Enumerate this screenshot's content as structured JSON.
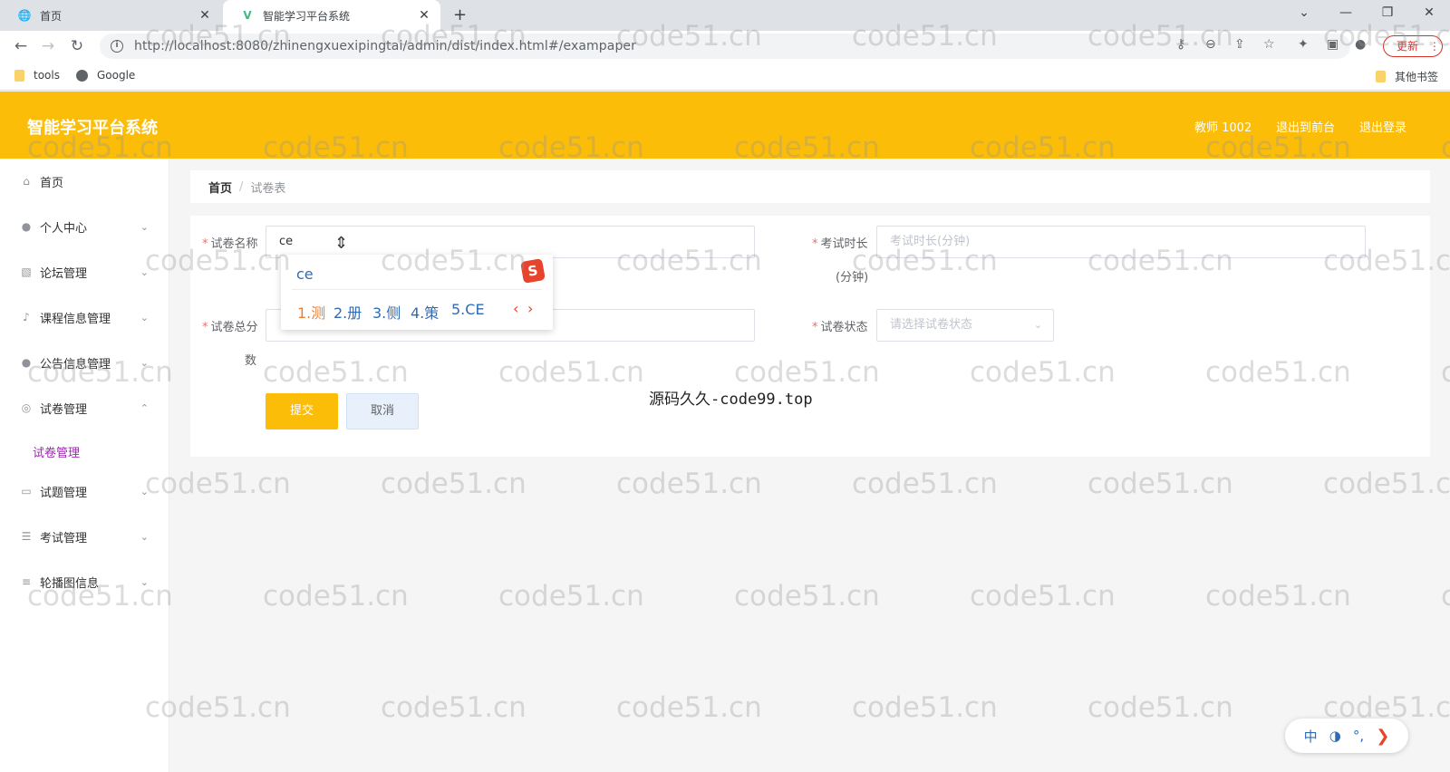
{
  "browser": {
    "tabs": [
      {
        "label": "首页",
        "favicon": "globe-icon",
        "active": false
      },
      {
        "label": "智能学习平台系统",
        "favicon": "vue-icon",
        "active": true
      }
    ],
    "new_tab": "+",
    "url": "http://localhost:8080/zhinengxuexipingtai/admin/dist/index.html#/exampaper",
    "update_label": "更新",
    "bookmarks": [
      {
        "label": "tools",
        "icon": "folder-icon"
      },
      {
        "label": "Google",
        "icon": "globe-icon"
      }
    ],
    "other_bookmarks": "其他书签"
  },
  "header": {
    "title": "智能学习平台系统",
    "user": "教师 1002",
    "to_front": "退出到前台",
    "logout": "退出登录",
    "bg_color": "#fbbd08"
  },
  "sidebar": {
    "items": [
      {
        "label": "首页",
        "icon": "home-icon"
      },
      {
        "label": "个人中心",
        "icon": "user-icon"
      },
      {
        "label": "论坛管理",
        "icon": "forum-icon"
      },
      {
        "label": "课程信息管理",
        "icon": "mic-icon"
      },
      {
        "label": "公告信息管理",
        "icon": "user-icon"
      },
      {
        "label": "试卷管理",
        "icon": "settings-icon",
        "expanded": true
      },
      {
        "label": "试题管理",
        "icon": "card-icon"
      },
      {
        "label": "考试管理",
        "icon": "sliders-icon"
      },
      {
        "label": "轮播图信息",
        "icon": "list-icon"
      }
    ],
    "sub_item": "试卷管理"
  },
  "breadcrumb": {
    "home": "首页",
    "separator": "/",
    "current": "试卷表"
  },
  "form": {
    "name_label": "试卷名称",
    "name_value": "ce",
    "duration_label": "考试时长",
    "duration_label_line2": "(分钟)",
    "duration_placeholder": "考试时长(分钟)",
    "total_label": "试卷总分",
    "total_label_line2": "数",
    "status_label": "试卷状态",
    "status_placeholder": "请选择试卷状态",
    "submit": "提交",
    "cancel": "取消"
  },
  "ime": {
    "composition": "ce",
    "candidates": [
      "1.测",
      "2.册",
      "3.侧",
      "4.策",
      "5.CE"
    ],
    "bar": [
      "中",
      "◑",
      "°,",
      "❯"
    ]
  },
  "watermark": {
    "text": "code51.cn",
    "caption": "源码久久-code99.top"
  }
}
